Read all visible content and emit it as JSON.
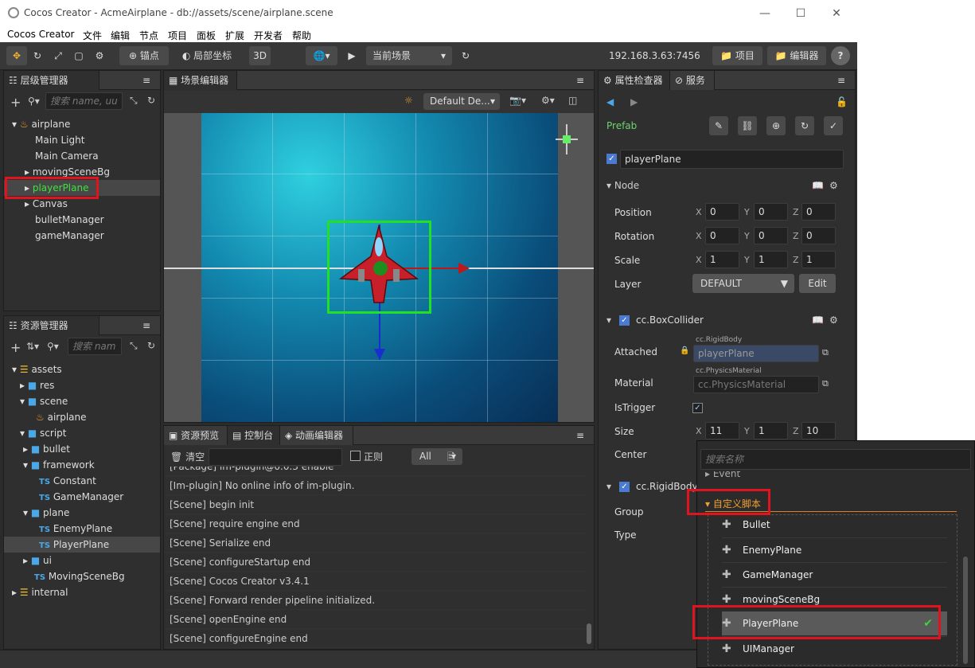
{
  "window": {
    "title": "Cocos Creator - AcmeAirplane - db://assets/scene/airplane.scene"
  },
  "menu": [
    "Cocos Creator",
    "文件",
    "编辑",
    "节点",
    "项目",
    "面板",
    "扩展",
    "开发者",
    "帮助"
  ],
  "toolbar": {
    "anchor": "锚点",
    "local_coord": "局部坐标",
    "mode_3d": "3D",
    "scene_select": "当前场景",
    "ip": "192.168.3.63:7456",
    "project": "项目",
    "editor": "编辑器"
  },
  "hierarchy": {
    "title": "层级管理器",
    "search_placeholder": "搜索 name, uu",
    "root": "airplane",
    "items": [
      "Main Light",
      "Main Camera",
      "movingSceneBg",
      "playerPlane",
      "Canvas",
      "bulletManager",
      "gameManager"
    ]
  },
  "assets": {
    "title": "资源管理器",
    "search_placeholder": "搜索 nam",
    "tree": [
      "assets",
      "res",
      "scene",
      "airplane",
      "script",
      "bullet",
      "framework",
      "Constant",
      "GameManager",
      "plane",
      "EnemyPlane",
      "PlayerPlane",
      "ui",
      "MovingSceneBg",
      "internal"
    ]
  },
  "scene_editor": {
    "title": "场景编辑器",
    "camera": "Default De..."
  },
  "console": {
    "tabs": [
      "资源预览",
      "控制台",
      "动画编辑器"
    ],
    "clear": "清空",
    "regex": "正则",
    "level": "All",
    "lines": [
      "[Package] im-plugin@0.0.3 enable",
      "[Im-plugin] No online info of im-plugin.",
      "[Scene] begin init",
      "[Scene] require engine end",
      "[Scene] Serialize end",
      "[Scene] configureStartup end",
      "[Scene] Cocos Creator v3.4.1",
      "[Scene] Forward render pipeline initialized.",
      "[Scene] openEngine end",
      "[Scene] configureEngine end"
    ]
  },
  "inspector": {
    "title": "属性检查器",
    "service": "服务",
    "prefab": "Prefab",
    "node_name": "playerPlane",
    "node_section": "Node",
    "position": "Position",
    "rotation": "Rotation",
    "scale": "Scale",
    "layer": "Layer",
    "pos": [
      "0",
      "0",
      "0"
    ],
    "rot": [
      "0",
      "0",
      "0"
    ],
    "scl": [
      "1",
      "1",
      "1"
    ],
    "layer_value": "DEFAULT",
    "edit": "Edit",
    "boxcollider": "cc.BoxCollider",
    "attached": "Attached",
    "attached_tag": "cc.RigidBody",
    "attached_value": "playerPlane",
    "material": "Material",
    "material_tag": "cc.PhysicsMaterial",
    "material_value": "cc.PhysicsMaterial",
    "istrigger": "IsTrigger",
    "size": "Size",
    "size_vals": [
      "11",
      "1",
      "10"
    ],
    "center": "Center",
    "rigidbody": "cc.RigidBody",
    "group": "Group",
    "type": "Type",
    "x": "X",
    "y": "Y",
    "z": "Z"
  },
  "popup": {
    "search_placeholder": "搜索名称",
    "event_partial": "Event",
    "category": "自定义脚本",
    "items": [
      "Bullet",
      "EnemyPlane",
      "GameManager",
      "movingSceneBg",
      "PlayerPlane",
      "UIManager"
    ]
  },
  "colors": {
    "accent": "#e0141e",
    "highlight": "#3de23d",
    "prefab": "#6ed36e"
  }
}
